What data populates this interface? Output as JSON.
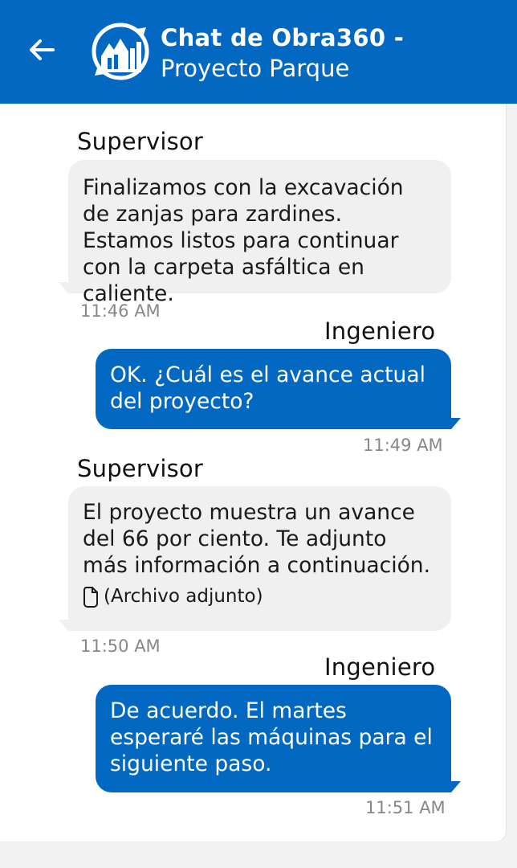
{
  "header": {
    "title_line1": "Chat de Obra360 -",
    "title_line2": "Proyecto Parque",
    "back_icon": "arrow-left-icon",
    "logo_icon": "obra360-logo-icon",
    "bg_color": "#0268c1"
  },
  "messages": [
    {
      "sender": "Supervisor",
      "direction": "incoming",
      "text": "Finalizamos con la excavación de zanjas para zardines. Estamos listos para continuar con la carpeta asfáltica en caliente.",
      "time": "11:46 AM"
    },
    {
      "sender": "Ingeniero",
      "direction": "outgoing",
      "text": "OK. ¿Cuál es el avance actual del proyecto?",
      "time": "11:49 AM"
    },
    {
      "sender": "Supervisor",
      "direction": "incoming",
      "text": "El proyecto muestra un avance del 66 por ciento. Te adjunto más información a continuación.",
      "attachment": "(Archivo adjunto)",
      "attachment_icon": "file-icon",
      "time": "11:50 AM"
    },
    {
      "sender": "Ingeniero",
      "direction": "outgoing",
      "text": "De acuerdo. El martes esperaré las máquinas para el siguiente paso.",
      "time": "11:51 AM"
    }
  ],
  "colors": {
    "outgoing_bubble": "#0268c1",
    "incoming_bubble": "#f0f0f0",
    "timestamp": "#888888"
  }
}
